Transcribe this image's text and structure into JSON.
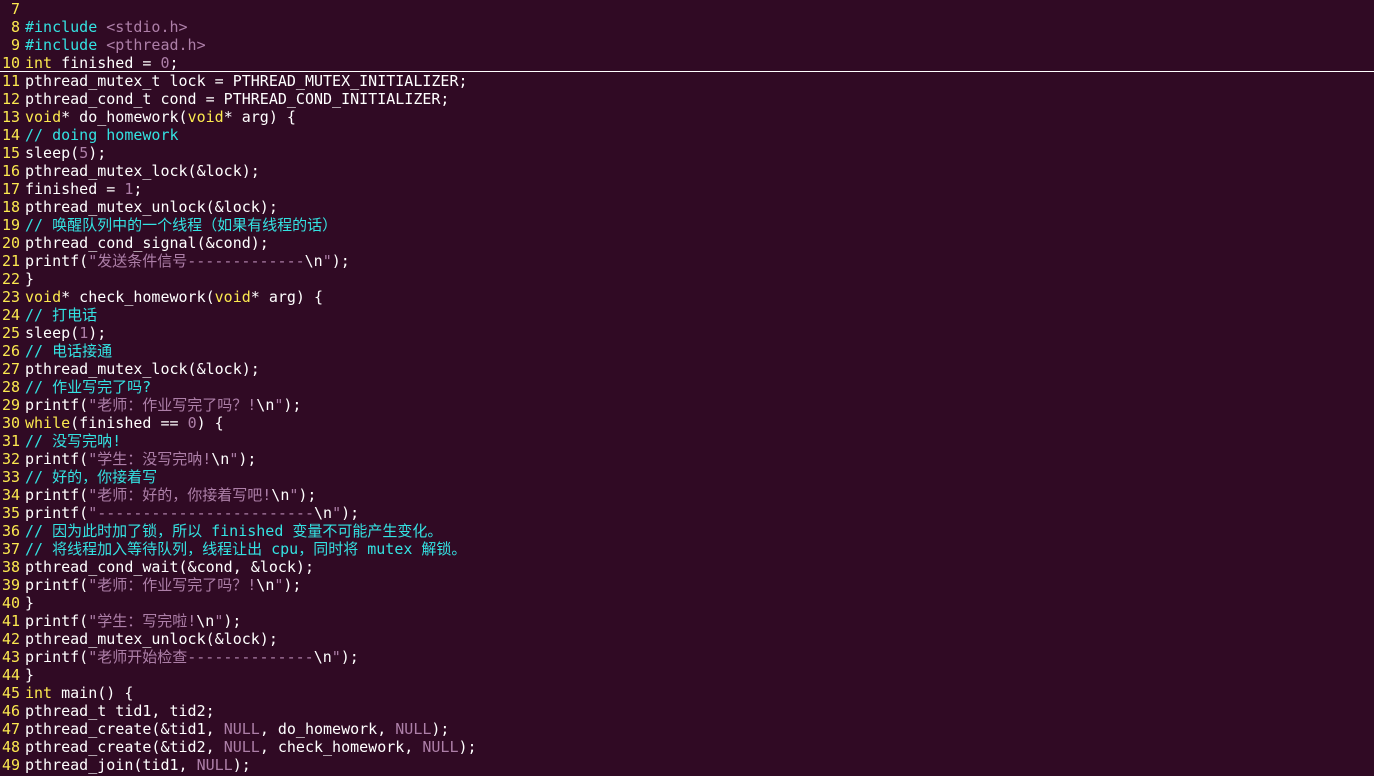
{
  "colors": {
    "background": "#300a24",
    "line_number": "#fce94f",
    "keyword": "#fce94f",
    "string": "#ad7fa8",
    "comment": "#34e2e2",
    "text": "#ffffff"
  },
  "editor": {
    "cursor_line": 10,
    "lines": [
      {
        "n": "7",
        "tokens": []
      },
      {
        "n": "8",
        "tokens": [
          {
            "t": "inc",
            "v": "#include"
          },
          {
            "t": "id",
            "v": " "
          },
          {
            "t": "pp",
            "v": "<stdio.h>"
          }
        ]
      },
      {
        "n": "9",
        "tokens": [
          {
            "t": "inc",
            "v": "#include"
          },
          {
            "t": "id",
            "v": " "
          },
          {
            "t": "pp",
            "v": "<pthread.h>"
          }
        ]
      },
      {
        "n": "10",
        "tokens": [
          {
            "t": "kw",
            "v": "int"
          },
          {
            "t": "id",
            "v": " finished = "
          },
          {
            "t": "num",
            "v": "0"
          },
          {
            "t": "id",
            "v": ";"
          }
        ]
      },
      {
        "n": "11",
        "tokens": [
          {
            "t": "id",
            "v": "pthread_mutex_t lock = PTHREAD_MUTEX_INITIALIZER;"
          }
        ]
      },
      {
        "n": "12",
        "tokens": [
          {
            "t": "id",
            "v": "pthread_cond_t cond = PTHREAD_COND_INITIALIZER;"
          }
        ]
      },
      {
        "n": "13",
        "tokens": [
          {
            "t": "kw",
            "v": "void"
          },
          {
            "t": "id",
            "v": "* do_homework("
          },
          {
            "t": "kw",
            "v": "void"
          },
          {
            "t": "id",
            "v": "* arg) {"
          }
        ]
      },
      {
        "n": "14",
        "tokens": [
          {
            "t": "cm",
            "v": "// doing homework"
          }
        ]
      },
      {
        "n": "15",
        "tokens": [
          {
            "t": "id",
            "v": "sleep("
          },
          {
            "t": "num",
            "v": "5"
          },
          {
            "t": "id",
            "v": ");"
          }
        ]
      },
      {
        "n": "16",
        "tokens": [
          {
            "t": "id",
            "v": "pthread_mutex_lock(&lock);"
          }
        ]
      },
      {
        "n": "17",
        "tokens": [
          {
            "t": "id",
            "v": "finished = "
          },
          {
            "t": "num",
            "v": "1"
          },
          {
            "t": "id",
            "v": ";"
          }
        ]
      },
      {
        "n": "18",
        "tokens": [
          {
            "t": "id",
            "v": "pthread_mutex_unlock(&lock);"
          }
        ]
      },
      {
        "n": "19",
        "tokens": [
          {
            "t": "cm",
            "v": "// 唤醒队列中的一个线程（如果有线程的话）"
          }
        ]
      },
      {
        "n": "20",
        "tokens": [
          {
            "t": "id",
            "v": "pthread_cond_signal(&cond);"
          }
        ]
      },
      {
        "n": "21",
        "tokens": [
          {
            "t": "id",
            "v": "printf("
          },
          {
            "t": "str",
            "v": "\"发送条件信号-------------"
          },
          {
            "t": "esc",
            "v": "\\n"
          },
          {
            "t": "str",
            "v": "\""
          },
          {
            "t": "id",
            "v": ");"
          }
        ]
      },
      {
        "n": "22",
        "tokens": [
          {
            "t": "id",
            "v": "}"
          }
        ]
      },
      {
        "n": "23",
        "tokens": [
          {
            "t": "kw",
            "v": "void"
          },
          {
            "t": "id",
            "v": "* check_homework("
          },
          {
            "t": "kw",
            "v": "void"
          },
          {
            "t": "id",
            "v": "* arg) {"
          }
        ]
      },
      {
        "n": "24",
        "tokens": [
          {
            "t": "cm",
            "v": "// 打电话"
          }
        ]
      },
      {
        "n": "25",
        "tokens": [
          {
            "t": "id",
            "v": "sleep("
          },
          {
            "t": "num",
            "v": "1"
          },
          {
            "t": "id",
            "v": ");"
          }
        ]
      },
      {
        "n": "26",
        "tokens": [
          {
            "t": "cm",
            "v": "// 电话接通"
          }
        ]
      },
      {
        "n": "27",
        "tokens": [
          {
            "t": "id",
            "v": "pthread_mutex_lock(&lock);"
          }
        ]
      },
      {
        "n": "28",
        "tokens": [
          {
            "t": "cm",
            "v": "// 作业写完了吗?"
          }
        ]
      },
      {
        "n": "29",
        "tokens": [
          {
            "t": "id",
            "v": "printf("
          },
          {
            "t": "str",
            "v": "\"老师：作业写完了吗？!"
          },
          {
            "t": "esc",
            "v": "\\n"
          },
          {
            "t": "str",
            "v": "\""
          },
          {
            "t": "id",
            "v": ");"
          }
        ]
      },
      {
        "n": "30",
        "tokens": [
          {
            "t": "kw",
            "v": "while"
          },
          {
            "t": "id",
            "v": "(finished == "
          },
          {
            "t": "num",
            "v": "0"
          },
          {
            "t": "id",
            "v": ") {"
          }
        ]
      },
      {
        "n": "31",
        "tokens": [
          {
            "t": "cm",
            "v": "// 没写完呐!"
          }
        ]
      },
      {
        "n": "32",
        "tokens": [
          {
            "t": "id",
            "v": "printf("
          },
          {
            "t": "str",
            "v": "\"学生：没写完呐!"
          },
          {
            "t": "esc",
            "v": "\\n"
          },
          {
            "t": "str",
            "v": "\""
          },
          {
            "t": "id",
            "v": ");"
          }
        ]
      },
      {
        "n": "33",
        "tokens": [
          {
            "t": "cm",
            "v": "// 好的，你接着写"
          }
        ]
      },
      {
        "n": "34",
        "tokens": [
          {
            "t": "id",
            "v": "printf("
          },
          {
            "t": "str",
            "v": "\"老师：好的，你接着写吧!"
          },
          {
            "t": "esc",
            "v": "\\n"
          },
          {
            "t": "str",
            "v": "\""
          },
          {
            "t": "id",
            "v": ");"
          }
        ]
      },
      {
        "n": "35",
        "tokens": [
          {
            "t": "id",
            "v": "printf("
          },
          {
            "t": "str",
            "v": "\"------------------------"
          },
          {
            "t": "esc",
            "v": "\\n"
          },
          {
            "t": "str",
            "v": "\""
          },
          {
            "t": "id",
            "v": ");"
          }
        ]
      },
      {
        "n": "36",
        "tokens": [
          {
            "t": "cm",
            "v": "// 因为此时加了锁，所以 finished 变量不可能产生变化。"
          }
        ]
      },
      {
        "n": "37",
        "tokens": [
          {
            "t": "cm",
            "v": "// 将线程加入等待队列，线程让出 cpu，同时将 mutex 解锁。"
          }
        ]
      },
      {
        "n": "38",
        "tokens": [
          {
            "t": "id",
            "v": "pthread_cond_wait(&cond, &lock);"
          }
        ]
      },
      {
        "n": "39",
        "tokens": [
          {
            "t": "id",
            "v": "printf("
          },
          {
            "t": "str",
            "v": "\"老师：作业写完了吗？!"
          },
          {
            "t": "esc",
            "v": "\\n"
          },
          {
            "t": "str",
            "v": "\""
          },
          {
            "t": "id",
            "v": ");"
          }
        ]
      },
      {
        "n": "40",
        "tokens": [
          {
            "t": "id",
            "v": "}"
          }
        ]
      },
      {
        "n": "41",
        "tokens": [
          {
            "t": "id",
            "v": "printf("
          },
          {
            "t": "str",
            "v": "\"学生：写完啦!"
          },
          {
            "t": "esc",
            "v": "\\n"
          },
          {
            "t": "str",
            "v": "\""
          },
          {
            "t": "id",
            "v": ");"
          }
        ]
      },
      {
        "n": "42",
        "tokens": [
          {
            "t": "id",
            "v": "pthread_mutex_unlock(&lock);"
          }
        ]
      },
      {
        "n": "43",
        "tokens": [
          {
            "t": "id",
            "v": "printf("
          },
          {
            "t": "str",
            "v": "\"老师开始检查--------------"
          },
          {
            "t": "esc",
            "v": "\\n"
          },
          {
            "t": "str",
            "v": "\""
          },
          {
            "t": "id",
            "v": ");"
          }
        ]
      },
      {
        "n": "44",
        "tokens": [
          {
            "t": "id",
            "v": "}"
          }
        ]
      },
      {
        "n": "45",
        "tokens": [
          {
            "t": "kw",
            "v": "int"
          },
          {
            "t": "id",
            "v": " main() {"
          }
        ]
      },
      {
        "n": "46",
        "tokens": [
          {
            "t": "id",
            "v": "pthread_t tid1, tid2;"
          }
        ]
      },
      {
        "n": "47",
        "tokens": [
          {
            "t": "id",
            "v": "pthread_create(&tid1, "
          },
          {
            "t": "num",
            "v": "NULL"
          },
          {
            "t": "id",
            "v": ", do_homework, "
          },
          {
            "t": "num",
            "v": "NULL"
          },
          {
            "t": "id",
            "v": ");"
          }
        ]
      },
      {
        "n": "48",
        "tokens": [
          {
            "t": "id",
            "v": "pthread_create(&tid2, "
          },
          {
            "t": "num",
            "v": "NULL"
          },
          {
            "t": "id",
            "v": ", check_homework, "
          },
          {
            "t": "num",
            "v": "NULL"
          },
          {
            "t": "id",
            "v": ");"
          }
        ]
      },
      {
        "n": "49",
        "tokens": [
          {
            "t": "id",
            "v": "pthread_join(tid1, "
          },
          {
            "t": "num",
            "v": "NULL"
          },
          {
            "t": "id",
            "v": ");"
          }
        ]
      }
    ]
  }
}
